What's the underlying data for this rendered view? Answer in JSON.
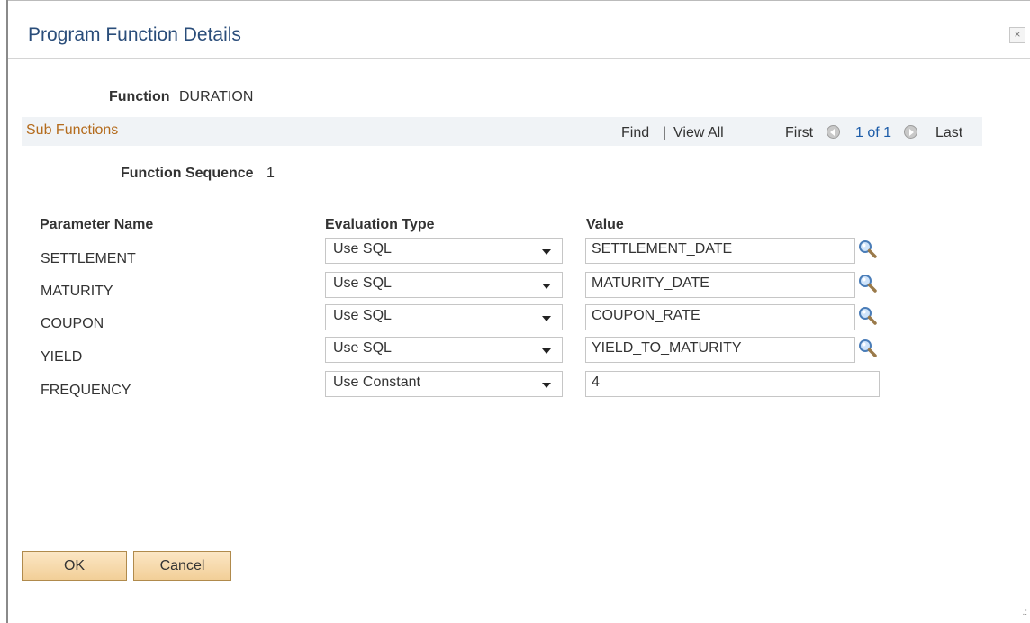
{
  "dialog": {
    "title": "Program Function Details",
    "close_glyph": "×"
  },
  "function": {
    "label": "Function",
    "value": "DURATION"
  },
  "sub_functions": {
    "title": "Sub Functions",
    "find": "Find",
    "separator": "|",
    "view_all": "View All",
    "first": "First",
    "page_info": "1 of 1",
    "last": "Last"
  },
  "sequence": {
    "label": "Function Sequence",
    "value": "1"
  },
  "columns": {
    "param": "Parameter Name",
    "eval": "Evaluation Type",
    "value": "Value"
  },
  "rows": [
    {
      "name": "SETTLEMENT",
      "eval": "Use SQL",
      "value": "SETTLEMENT_DATE"
    },
    {
      "name": "MATURITY",
      "eval": "Use SQL",
      "value": "MATURITY_DATE"
    },
    {
      "name": "COUPON",
      "eval": "Use SQL",
      "value": "COUPON_RATE"
    },
    {
      "name": "YIELD",
      "eval": "Use SQL",
      "value": "YIELD_TO_MATURITY"
    },
    {
      "name": "FREQUENCY",
      "eval": "Use Constant",
      "value": "4"
    }
  ],
  "buttons": {
    "ok": "OK",
    "cancel": "Cancel"
  },
  "icons": {
    "lookup": "magnifier-icon",
    "prev": "arrow-left-circle-icon",
    "next": "arrow-right-circle-icon",
    "dropdown": "caret-down-icon",
    "resize": "resize-grip-icon"
  },
  "colors": {
    "title": "#2a4d7a",
    "section_title": "#b46b1c",
    "link": "#1d5ca8",
    "button_fill": "#f2cf98"
  }
}
